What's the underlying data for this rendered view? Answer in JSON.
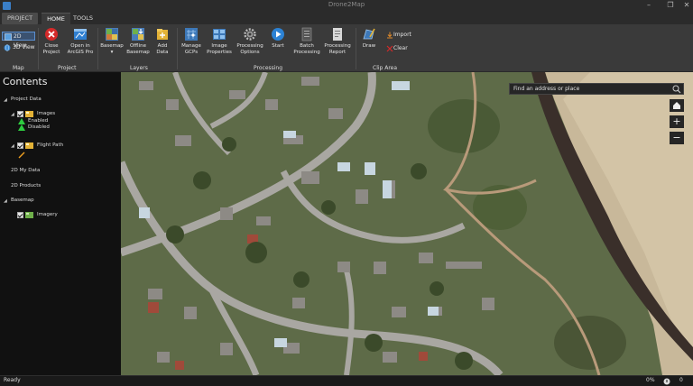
{
  "window": {
    "title": "Drone2Map",
    "icons": {
      "app": "drone2map-logo-icon",
      "minimize": "minimize-icon",
      "maximize": "maximize-icon",
      "close": "close-icon"
    }
  },
  "tabs": [
    {
      "label": "PROJECT",
      "active": false
    },
    {
      "label": "HOME",
      "active": true
    },
    {
      "label": "TOOLS",
      "active": false
    }
  ],
  "ribbon": {
    "map": {
      "group_label": "Map",
      "view2d": "2D View",
      "view3d": "3D View"
    },
    "project": {
      "group_label": "Project",
      "close_line1": "Close",
      "close_line2": "Project",
      "open_line1": "Open in",
      "open_line2": "ArcGIS Pro"
    },
    "layers": {
      "group_label": "Layers",
      "basemap_line1": "Basemap",
      "basemap_line2": "▾",
      "offline_line1": "Offline",
      "offline_line2": "Basemap",
      "add_line1": "Add",
      "add_line2": "Data"
    },
    "processing": {
      "group_label": "Processing",
      "gcps_line1": "Manage",
      "gcps_line2": "GCPs",
      "images_line1": "Image",
      "images_line2": "Properties",
      "options_line1": "Processing",
      "options_line2": "Options",
      "start": "Start",
      "batch_line1": "Batch",
      "batch_line2": "Processing",
      "report_line1": "Processing",
      "report_line2": "Report"
    },
    "clip": {
      "group_label": "Clip Area",
      "draw": "Draw",
      "import": "Import",
      "clear": "Clear"
    }
  },
  "contents": {
    "title": "Contents",
    "project_data": "Project Data",
    "images": "Images",
    "enabled": "Enabled",
    "disabled": "Disabled",
    "flight_path": "Flight Path",
    "my_data_2d": "2D My Data",
    "products_2d": "2D Products",
    "basemap": "Basemap",
    "imagery": "Imagery",
    "colors": {
      "enabled": "#2ecc40",
      "disabled": "#2ecc40",
      "flight_path": "#f0a020"
    }
  },
  "map": {
    "search_placeholder": "Find an address or place",
    "home_icon": "home-icon",
    "zoom_in": "+",
    "zoom_out": "−"
  },
  "status": {
    "text": "Ready",
    "progress": "0%",
    "notifications": "0"
  }
}
